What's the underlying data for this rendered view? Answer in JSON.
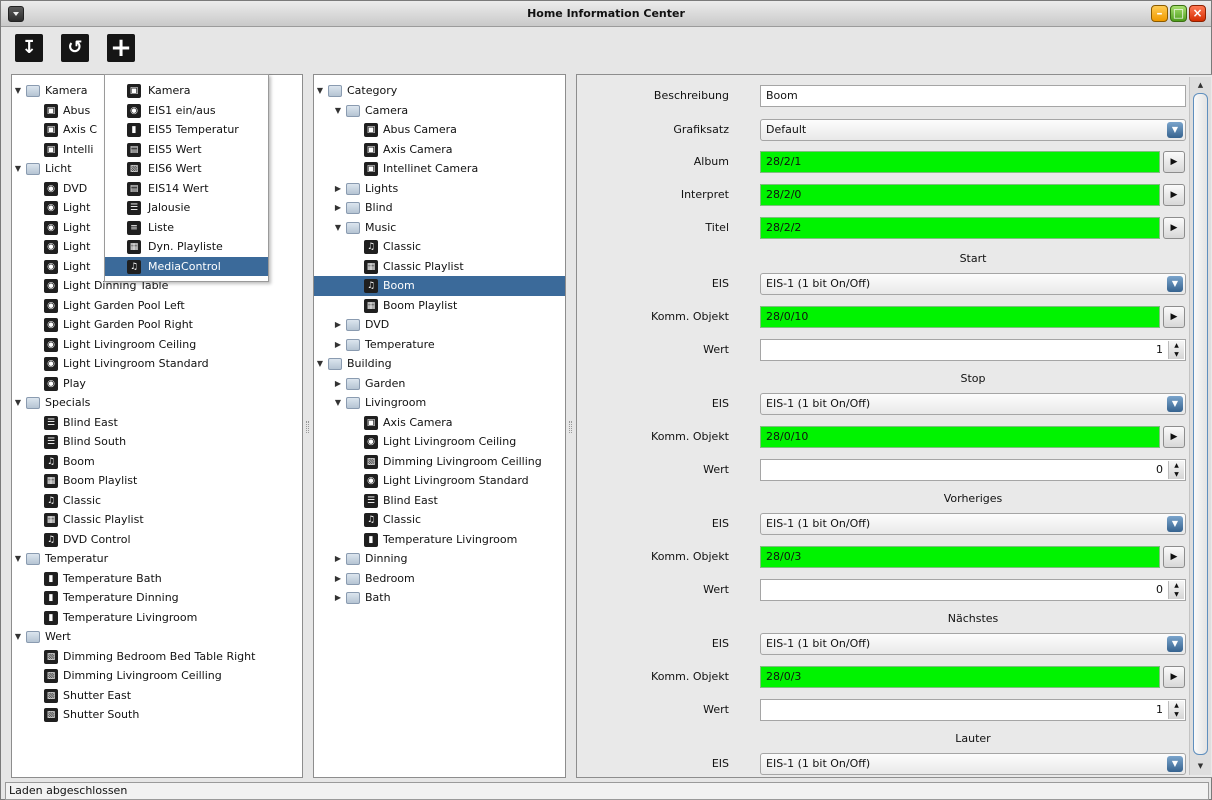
{
  "window": {
    "title": "Home Information Center",
    "app_icon": "app-menu-icon"
  },
  "toolbar": {
    "buttons": [
      {
        "name": "save-button",
        "icon": "save-icon",
        "glyph": "↧"
      },
      {
        "name": "undo-button",
        "icon": "undo-icon",
        "glyph": "↺"
      },
      {
        "name": "add-button",
        "icon": "plus-icon",
        "glyph": "+"
      }
    ]
  },
  "left_tree": [
    {
      "label": "Kamera",
      "depth": 0,
      "folder": true,
      "open": true
    },
    {
      "label": "Abus",
      "depth": 1,
      "icon": "camera-icon"
    },
    {
      "label": "Axis C",
      "depth": 1,
      "icon": "camera-icon"
    },
    {
      "label": "Intelli",
      "depth": 1,
      "icon": "camera-icon"
    },
    {
      "label": "Licht",
      "depth": 0,
      "folder": true,
      "open": true
    },
    {
      "label": "DVD",
      "depth": 1,
      "icon": "bulb-icon"
    },
    {
      "label": "Light",
      "depth": 1,
      "icon": "bulb-icon"
    },
    {
      "label": "Light",
      "depth": 1,
      "icon": "bulb-icon"
    },
    {
      "label": "Light",
      "depth": 1,
      "icon": "bulb-icon"
    },
    {
      "label": "Light",
      "depth": 1,
      "icon": "bulb-icon"
    },
    {
      "label": "Light Dinning Table",
      "depth": 1,
      "icon": "bulb-icon"
    },
    {
      "label": "Light Garden Pool Left",
      "depth": 1,
      "icon": "bulb-icon"
    },
    {
      "label": "Light Garden Pool Right",
      "depth": 1,
      "icon": "bulb-icon"
    },
    {
      "label": "Light Livingroom Ceiling",
      "depth": 1,
      "icon": "bulb-icon"
    },
    {
      "label": "Light Livingroom Standard",
      "depth": 1,
      "icon": "bulb-icon"
    },
    {
      "label": "Play",
      "depth": 1,
      "icon": "bulb-icon"
    },
    {
      "label": "Specials",
      "depth": 0,
      "folder": true,
      "open": true
    },
    {
      "label": "Blind East",
      "depth": 1,
      "icon": "blind-icon"
    },
    {
      "label": "Blind South",
      "depth": 1,
      "icon": "blind-icon"
    },
    {
      "label": "Boom",
      "depth": 1,
      "icon": "music-icon"
    },
    {
      "label": "Boom Playlist",
      "depth": 1,
      "icon": "playlist-icon"
    },
    {
      "label": "Classic",
      "depth": 1,
      "icon": "music-icon"
    },
    {
      "label": "Classic Playlist",
      "depth": 1,
      "icon": "playlist-icon"
    },
    {
      "label": "DVD Control",
      "depth": 1,
      "icon": "music-icon"
    },
    {
      "label": "Temperatur",
      "depth": 0,
      "folder": true,
      "open": true
    },
    {
      "label": "Temperature Bath",
      "depth": 1,
      "icon": "thermometer-icon"
    },
    {
      "label": "Temperature Dinning",
      "depth": 1,
      "icon": "thermometer-icon"
    },
    {
      "label": "Temperature Livingroom",
      "depth": 1,
      "icon": "thermometer-icon"
    },
    {
      "label": "Wert",
      "depth": 0,
      "folder": true,
      "open": true
    },
    {
      "label": "Dimming Bedroom Bed Table Right",
      "depth": 1,
      "icon": "dimmer-icon"
    },
    {
      "label": "Dimming Livingroom Ceilling",
      "depth": 1,
      "icon": "dimmer-icon"
    },
    {
      "label": "Shutter East",
      "depth": 1,
      "icon": "dimmer-icon"
    },
    {
      "label": "Shutter South",
      "depth": 1,
      "icon": "dimmer-icon"
    }
  ],
  "popup_menu": [
    {
      "label": "Kamera",
      "icon": "camera-icon"
    },
    {
      "label": "EIS1 ein/aus",
      "icon": "bulb-icon"
    },
    {
      "label": "EIS5 Temperatur",
      "icon": "thermometer-icon"
    },
    {
      "label": "EIS5 Wert",
      "icon": "value-icon"
    },
    {
      "label": "EIS6 Wert",
      "icon": "dimmer-icon"
    },
    {
      "label": "EIS14 Wert",
      "icon": "value-icon"
    },
    {
      "label": "Jalousie",
      "icon": "blind-icon"
    },
    {
      "label": "Liste",
      "icon": "list-icon"
    },
    {
      "label": "Dyn. Playliste",
      "icon": "playlist-icon"
    },
    {
      "label": "MediaControl",
      "icon": "music-icon",
      "selected": true
    }
  ],
  "mid_tree": [
    {
      "label": "Category",
      "depth": 0,
      "folder": true,
      "open": true
    },
    {
      "label": "Camera",
      "depth": 1,
      "folder": true,
      "open": true
    },
    {
      "label": "Abus Camera",
      "depth": 2,
      "icon": "camera-icon"
    },
    {
      "label": "Axis Camera",
      "depth": 2,
      "icon": "camera-icon"
    },
    {
      "label": "Intellinet Camera",
      "depth": 2,
      "icon": "camera-icon"
    },
    {
      "label": "Lights",
      "depth": 1,
      "folder": true,
      "open": false
    },
    {
      "label": "Blind",
      "depth": 1,
      "folder": true,
      "open": false
    },
    {
      "label": "Music",
      "depth": 1,
      "folder": true,
      "open": true
    },
    {
      "label": "Classic",
      "depth": 2,
      "icon": "music-icon"
    },
    {
      "label": "Classic Playlist",
      "depth": 2,
      "icon": "playlist-icon"
    },
    {
      "label": "Boom",
      "depth": 2,
      "icon": "music-icon",
      "selected": true
    },
    {
      "label": "Boom Playlist",
      "depth": 2,
      "icon": "playlist-icon"
    },
    {
      "label": "DVD",
      "depth": 1,
      "folder": true,
      "open": false
    },
    {
      "label": "Temperature",
      "depth": 1,
      "folder": true,
      "open": false
    },
    {
      "label": "Building",
      "depth": 0,
      "folder": true,
      "open": true
    },
    {
      "label": "Garden",
      "depth": 1,
      "folder": true,
      "open": false
    },
    {
      "label": "Livingroom",
      "depth": 1,
      "folder": true,
      "open": true
    },
    {
      "label": "Axis Camera",
      "depth": 2,
      "icon": "camera-icon"
    },
    {
      "label": "Light Livingroom Ceiling",
      "depth": 2,
      "icon": "bulb-icon"
    },
    {
      "label": "Dimming Livingroom Ceilling",
      "depth": 2,
      "icon": "dimmer-icon"
    },
    {
      "label": "Light Livingroom Standard",
      "depth": 2,
      "icon": "bulb-icon"
    },
    {
      "label": "Blind East",
      "depth": 2,
      "icon": "blind-icon"
    },
    {
      "label": "Classic",
      "depth": 2,
      "icon": "music-icon"
    },
    {
      "label": "Temperature Livingroom",
      "depth": 2,
      "icon": "thermometer-icon"
    },
    {
      "label": "Dinning",
      "depth": 1,
      "folder": true,
      "open": false
    },
    {
      "label": "Bedroom",
      "depth": 1,
      "folder": true,
      "open": false
    },
    {
      "label": "Bath",
      "depth": 1,
      "folder": true,
      "open": false
    }
  ],
  "form": {
    "beschreibung_label": "Beschreibung",
    "beschreibung_value": "Boom",
    "grafiksatz_label": "Grafiksatz",
    "grafiksatz_value": "Default",
    "album_label": "Album",
    "album_value": "28/2/1",
    "interpret_label": "Interpret",
    "interpret_value": "28/2/0",
    "titel_label": "Titel",
    "titel_value": "28/2/2",
    "sections": [
      {
        "title": "Start",
        "eis_label": "EIS",
        "eis_value": "EIS-1 (1 bit On/Off)",
        "komm_label": "Komm. Objekt",
        "komm_value": "28/0/10",
        "wert_label": "Wert",
        "wert_value": "1"
      },
      {
        "title": "Stop",
        "eis_label": "EIS",
        "eis_value": "EIS-1 (1 bit On/Off)",
        "komm_label": "Komm. Objekt",
        "komm_value": "28/0/10",
        "wert_label": "Wert",
        "wert_value": "0"
      },
      {
        "title": "Vorheriges",
        "eis_label": "EIS",
        "eis_value": "EIS-1 (1 bit On/Off)",
        "komm_label": "Komm. Objekt",
        "komm_value": "28/0/3",
        "wert_label": "Wert",
        "wert_value": "0"
      },
      {
        "title": "Nächstes",
        "eis_label": "EIS",
        "eis_value": "EIS-1 (1 bit On/Off)",
        "komm_label": "Komm. Objekt",
        "komm_value": "28/0/3",
        "wert_label": "Wert",
        "wert_value": "1"
      },
      {
        "title": "Lauter",
        "eis_label": "EIS",
        "eis_value": "EIS-1 (1 bit On/Off)"
      }
    ]
  },
  "status": {
    "text": "Laden abgeschlossen"
  },
  "colors": {
    "selection": "#3b6a9a",
    "group_address": "#00f300"
  }
}
